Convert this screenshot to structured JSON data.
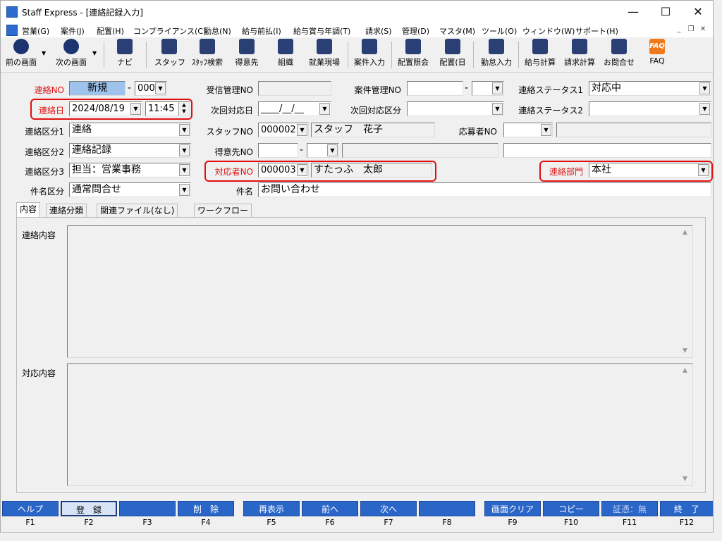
{
  "window": {
    "title": "Staff Express - [連絡記録入力]",
    "minimize": "—",
    "maximize": "☐",
    "close": "✕"
  },
  "menu": [
    "営業(G)",
    "案件(J)",
    "配置(H)",
    "コンプライアンス(C)",
    "勤怠(N)",
    "給与前払(I)",
    "給与賞与年調(T)",
    "請求(S)",
    "管理(D)",
    "マスタ(M)",
    "ツール(O)",
    "ウィンドウ(W)",
    "サポート(H)"
  ],
  "mdi_buttons": [
    "_",
    "❐",
    "✕"
  ],
  "toolbar": {
    "prev": "前の画面",
    "next": "次の画面",
    "navi": "ナビ",
    "staff": "スタッフ",
    "staff_search": "ｽﾀｯﾌ検索",
    "client": "得意先",
    "org": "組織",
    "worksite": "就業現場",
    "case_entry": "案件入力",
    "assign_inquiry": "配置照会",
    "assign_day": "配置(日",
    "attendance": "勤怠入力",
    "payroll": "給与計算",
    "billing": "請求計算",
    "contact": "お問合せ",
    "faq": "FAQ",
    "faq_icon": "FAQ"
  },
  "form": {
    "contact_no_label": "連絡NO",
    "contact_no_value": "新規",
    "contact_no_dash": "-",
    "contact_no_sub": "000",
    "contact_date_label": "連絡日",
    "contact_date_value": "2024/08/19",
    "contact_time_value": "11:45",
    "cat1_label": "連絡区分1",
    "cat1_value": "連絡",
    "cat2_label": "連絡区分2",
    "cat2_value": "連絡記録",
    "cat3_label": "連絡区分3",
    "cat3_value": "担当：営業事務",
    "subject_cat_label": "件名区分",
    "subject_cat_value": "通常問合せ",
    "recv_no_label": "受信管理NO",
    "recv_no_value": "",
    "next_date_label": "次回対応日",
    "next_date_value": "____/__/__",
    "staff_no_label": "スタッフNO",
    "staff_no_value": "000002",
    "staff_name_value": "スタッフ　花子",
    "client_no_label": "得意先NO",
    "client_dash": "-",
    "handler_no_label": "対応者NO",
    "handler_no_value": "000003",
    "handler_name_value": "すたっふ　太郎",
    "subject_label": "件名",
    "subject_value": "お問い合わせ",
    "case_no_label": "案件管理NO",
    "case_dash": "-",
    "next_cat_label": "次回対応区分",
    "applicant_no_label": "応募者NO",
    "status1_label": "連絡ステータス1",
    "status1_value": "対応中",
    "status2_label": "連絡ステータス2",
    "status2_value": "",
    "dept_label": "連絡部門",
    "dept_value": "本社"
  },
  "tabs": [
    "内容",
    "連絡分類",
    "関連ファイル(なし)",
    "ワークフロー"
  ],
  "panel": {
    "contact_content_label": "連絡内容",
    "response_content_label": "対応内容"
  },
  "fkeys": [
    {
      "label": "ヘルプ",
      "key": "F1"
    },
    {
      "label": "登　録",
      "key": "F2"
    },
    {
      "label": "",
      "key": "F3"
    },
    {
      "label": "削　除",
      "key": "F4"
    },
    {
      "label": "再表示",
      "key": "F5"
    },
    {
      "label": "前へ",
      "key": "F6"
    },
    {
      "label": "次へ",
      "key": "F7"
    },
    {
      "label": "",
      "key": "F8"
    },
    {
      "label": "画面クリア",
      "key": "F9"
    },
    {
      "label": "コピー",
      "key": "F10"
    },
    {
      "label": "証憑：無",
      "key": "F11"
    },
    {
      "label": "終　了",
      "key": "F12"
    }
  ],
  "colors": {
    "accent_blue": "#2a65c8",
    "highlight_red": "#e01010",
    "new_badge_blue": "#9ec4ee"
  }
}
